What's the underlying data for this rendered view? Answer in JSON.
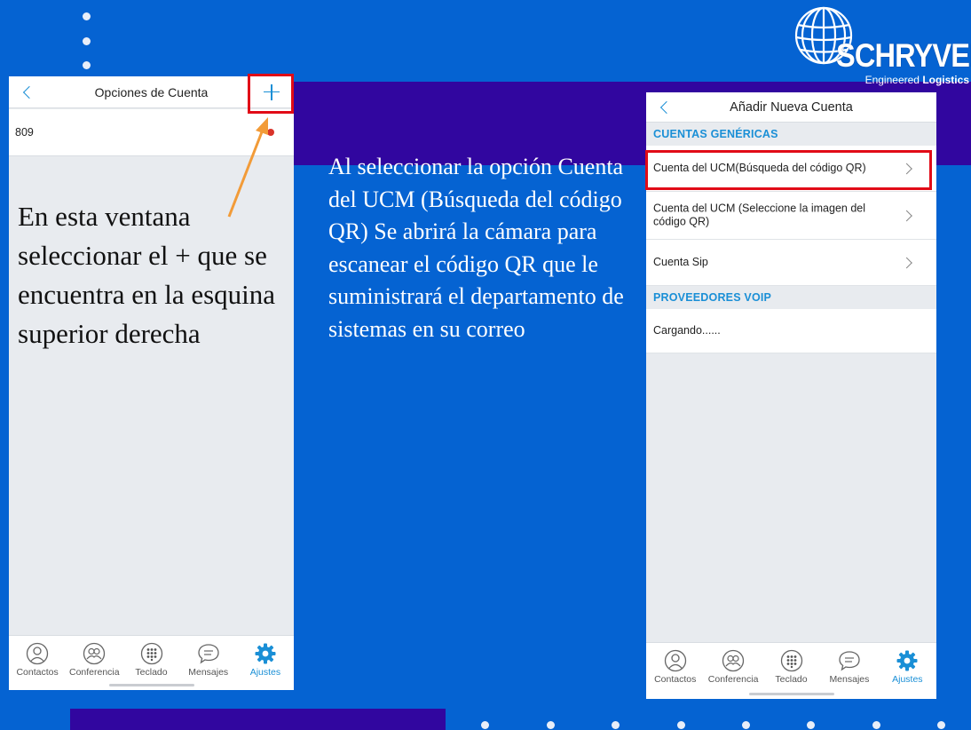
{
  "brand": {
    "name": "SCHRYVER",
    "tagline_prefix": "Engineered",
    "tagline_bold": "Logistics",
    "logo_icon": "globe-icon"
  },
  "colors": {
    "background": "#0563d2",
    "band": "#31069f",
    "accent": "#1a8fd6",
    "highlight": "#e10b17",
    "arrow": "#f29b38"
  },
  "screen_left": {
    "title": "Opciones de Cuenta",
    "account_number": "809",
    "add_icon": "plus-icon"
  },
  "screen_right": {
    "title": "Añadir Nueva Cuenta",
    "section_generic": "CUENTAS GENÉRICAS",
    "items": [
      {
        "label": "Cuenta del UCM(Búsqueda del código QR)"
      },
      {
        "label": "Cuenta del UCM (Seleccione la imagen del código QR)"
      },
      {
        "label": "Cuenta Sip"
      }
    ],
    "section_voip": "PROVEEDORES VOIP",
    "loading": "Cargando......"
  },
  "nav": {
    "items": [
      {
        "label": "Contactos",
        "icon": "contacts-icon"
      },
      {
        "label": "Conferencia",
        "icon": "conference-icon"
      },
      {
        "label": "Teclado",
        "icon": "dialpad-icon"
      },
      {
        "label": "Mensajes",
        "icon": "messages-icon"
      },
      {
        "label": "Ajustes",
        "icon": "gear-icon",
        "active": true
      }
    ]
  },
  "annotations": {
    "left": "En esta ventana seleccionar el + que se encuentra en la esquina superior derecha",
    "middle": "Al seleccionar la opción Cuenta del UCM (Búsqueda del código QR) Se abrirá la cámara para escanear el código QR que le suministrará el departamento de sistemas en su correo"
  }
}
